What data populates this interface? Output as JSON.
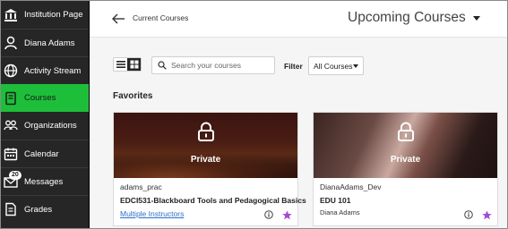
{
  "sidebar": {
    "items": [
      {
        "label": "Institution Page",
        "icon": "institution-icon"
      },
      {
        "label": "Diana Adams",
        "icon": "user-icon"
      },
      {
        "label": "Activity Stream",
        "icon": "globe-icon"
      },
      {
        "label": "Courses",
        "icon": "courses-icon",
        "active": true
      },
      {
        "label": "Organizations",
        "icon": "organizations-icon"
      },
      {
        "label": "Calendar",
        "icon": "calendar-icon"
      },
      {
        "label": "Messages",
        "icon": "envelope-icon",
        "badge": "20"
      },
      {
        "label": "Grades",
        "icon": "grades-icon"
      }
    ],
    "active_color": "#1dbf3a",
    "background": "#262626"
  },
  "header": {
    "breadcrumb": "Current Courses",
    "title": "Upcoming Courses"
  },
  "toolbar": {
    "search_placeholder": "Search your courses",
    "filter_label": "Filter",
    "filter_value": "All Courses"
  },
  "favorites": {
    "title": "Favorites",
    "cards": [
      {
        "privacy": "Private",
        "course_id": "adams_prac",
        "course_name": "EDCI531-Blackboard Tools and Pedagogical Basics",
        "instructors": "Multiple Instructors",
        "instructors_is_link": true
      },
      {
        "privacy": "Private",
        "course_id": "DianaAdams_Dev",
        "course_name": "EDU 101",
        "instructors": "Diana Adams",
        "instructors_is_link": false
      }
    ]
  },
  "colors": {
    "link": "#2a6fc9",
    "star": "#a24bd6"
  }
}
